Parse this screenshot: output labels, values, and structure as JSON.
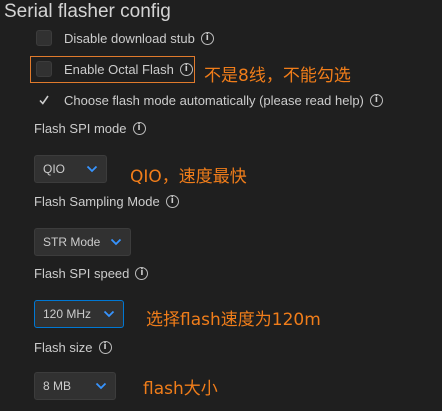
{
  "section_title": "Serial flasher config",
  "checkboxes": [
    {
      "label": "Disable download stub",
      "checked": false
    },
    {
      "label": "Enable Octal Flash",
      "checked": false
    },
    {
      "label": "Choose flash mode automatically (please read help)",
      "checked": true
    }
  ],
  "fields": [
    {
      "label": "Flash SPI mode",
      "value": "QIO"
    },
    {
      "label": "Flash Sampling Mode",
      "value": "STR Mode"
    },
    {
      "label": "Flash SPI speed",
      "value": "120 MHz"
    },
    {
      "label": "Flash size",
      "value": "8 MB"
    }
  ],
  "annotations": [
    "不是8线，不能勾选",
    "QIO，速度最快",
    "选择flash速度为120m",
    "flash大小"
  ],
  "icons": {
    "info": "info-icon",
    "check": "checkmark-icon",
    "chevron": "chevron-down-icon"
  },
  "colors": {
    "background": "#1f1f1f",
    "accent_focus": "#0078d4",
    "annotation": "#f07d1a",
    "chevron": "#3794ff"
  }
}
